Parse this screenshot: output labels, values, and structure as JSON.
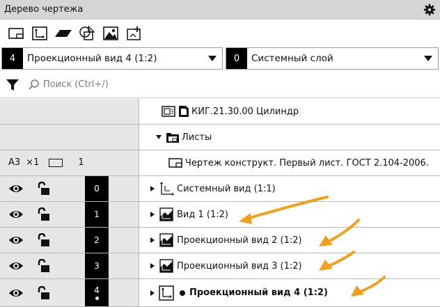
{
  "panel": {
    "title": "Дерево чертежа",
    "settings_icon": "gear-icon"
  },
  "toolbar": {
    "buttons": [
      {
        "name": "new-sheet-button",
        "icon": "sheet-icon"
      },
      {
        "name": "new-view-button",
        "icon": "view-axes-icon"
      },
      {
        "name": "layer-button",
        "icon": "layer-parallelogram-icon"
      },
      {
        "name": "geometry-button",
        "icon": "shapes-icon"
      },
      {
        "name": "image-button",
        "icon": "picture-icon"
      },
      {
        "name": "fragment-button",
        "icon": "fragment-icon"
      }
    ]
  },
  "view_select": {
    "number": "4",
    "label": "Проекционный вид 4 (1:2)"
  },
  "layer_select": {
    "number": "0",
    "label": "Системный слой"
  },
  "search": {
    "placeholder": "Поиск (Ctrl+/)"
  },
  "tree": {
    "document": {
      "label": "КИГ.21.30.00 Цилиндр"
    },
    "sheets": {
      "label": "Листы"
    },
    "sheet": {
      "format": "A3",
      "multiplier": "×1",
      "number": "1",
      "label": "Чертеж конструкт. Первый лист. ГОСТ 2.104-2006."
    },
    "views": [
      {
        "layer": "0",
        "label": "Системный вид (1:1)",
        "active": false
      },
      {
        "layer": "1",
        "label": "Вид 1 (1:2)",
        "active": false
      },
      {
        "layer": "2",
        "label": "Проекционный вид 2 (1:2)",
        "active": false
      },
      {
        "layer": "3",
        "label": "Проекционный вид 3 (1:2)",
        "active": false
      },
      {
        "layer": "4",
        "label": "Проекционный вид 4 (1:2)",
        "active": true
      }
    ]
  },
  "colors": {
    "arrow": "#f0a020",
    "header_bg": "#d6d6d6",
    "left_col_bg": "#e6e6e6"
  }
}
